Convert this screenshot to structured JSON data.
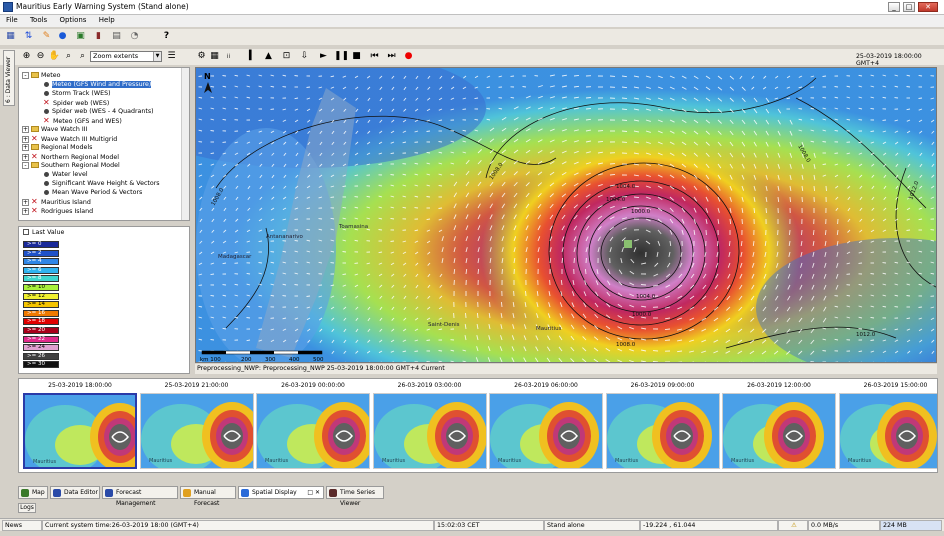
{
  "window": {
    "title": "Mauritius Early Warning System  (Stand alone)"
  },
  "menu": [
    "File",
    "Tools",
    "Options",
    "Help"
  ],
  "toolbar2": {
    "zoom_combo": "Zoom extents",
    "time_display": "25-03-2019 18:00:00 GMT+4"
  },
  "side_tab": "6 : Data Viewer",
  "tree": [
    {
      "label": "Meteo",
      "kind": "folder",
      "level": 0,
      "exp": "-"
    },
    {
      "label": "Meteo (GFS Wind and Pressure)",
      "kind": "dot",
      "level": 1,
      "selected": true
    },
    {
      "label": "Storm Track (WES)",
      "kind": "dot",
      "level": 1
    },
    {
      "label": "Spider web (WES)",
      "kind": "x",
      "level": 1
    },
    {
      "label": "Spider web (WES - 4 Quadrants)",
      "kind": "dot",
      "level": 1
    },
    {
      "label": "Meteo (GFS and WES)",
      "kind": "x",
      "level": 1
    },
    {
      "label": "Wave Watch III",
      "kind": "folder",
      "level": 0,
      "exp": "+"
    },
    {
      "label": "Wave Watch III Multigrid",
      "kind": "x",
      "level": 0,
      "exp": "+"
    },
    {
      "label": "Regional Models",
      "kind": "folder",
      "level": 0,
      "exp": "+"
    },
    {
      "label": "Northern Regional Model",
      "kind": "x",
      "level": 0,
      "exp": "+"
    },
    {
      "label": "Southern Regional Model",
      "kind": "folder",
      "level": 0,
      "exp": "-"
    },
    {
      "label": "Water level",
      "kind": "dot",
      "level": 1
    },
    {
      "label": "Significant Wave Height & Vectors",
      "kind": "dot",
      "level": 1
    },
    {
      "label": "Mean Wave Period & Vectors",
      "kind": "dot",
      "level": 1
    },
    {
      "label": "Mauritius Island",
      "kind": "x",
      "level": 0,
      "exp": "+"
    },
    {
      "label": "Rodrigues Island",
      "kind": "x",
      "level": 0,
      "exp": "+"
    }
  ],
  "legend": {
    "title": "Last Value",
    "rows": [
      {
        "label": ">= 0",
        "color": "#1a2a9a"
      },
      {
        "label": ">= 2",
        "color": "#1f52c8"
      },
      {
        "label": ">= 4",
        "color": "#2f86e6"
      },
      {
        "label": ">= 6",
        "color": "#2fb3f0"
      },
      {
        "label": ">= 8",
        "color": "#3ed6d0"
      },
      {
        "label": ">= 10",
        "color": "#a8f03a",
        "light": true
      },
      {
        "label": ">= 12",
        "color": "#f0f030",
        "light": true
      },
      {
        "label": ">= 14",
        "color": "#f5c400",
        "light": true
      },
      {
        "label": ">= 16",
        "color": "#f07a00"
      },
      {
        "label": ">= 18",
        "color": "#e00000"
      },
      {
        "label": ">= 20",
        "color": "#a8001a"
      },
      {
        "label": ">= 22",
        "color": "#e02a8a"
      },
      {
        "label": ">= 24",
        "color": "#e0a0d0",
        "light": true
      },
      {
        "label": ">= 26",
        "color": "#404040"
      },
      {
        "label": ">= 30",
        "color": "#101010"
      }
    ]
  },
  "map": {
    "north_label": "N",
    "scale_labels": [
      "km 100",
      "200",
      "300",
      "400",
      "500"
    ],
    "contour_labels": [
      "1008.0",
      "1008.0",
      "1004.0",
      "1004.0",
      "1000.0",
      "1008.0",
      "1012.0",
      "1012.0",
      "1004.0",
      "1000.0",
      "1008.0"
    ],
    "place_labels": [
      "Toamasina",
      "Antananarivo",
      "Madagascar",
      "Saint-Denis",
      "Mauritius"
    ],
    "status": "Preprocessing_NWP: Preprocessing_NWP 25-03-2019 18:00:00 GMT+4 Current"
  },
  "thumbnails": [
    {
      "label": "25-03-2019 18:00:00",
      "selected": true
    },
    {
      "label": "25-03-2019 21:00:00"
    },
    {
      "label": "26-03-2019 00:00:00"
    },
    {
      "label": "26-03-2019 03:00:00"
    },
    {
      "label": "26-03-2019 06:00:00"
    },
    {
      "label": "26-03-2019 09:00:00"
    },
    {
      "label": "26-03-2019 12:00:00"
    },
    {
      "label": "26-03-2019 15:00:00"
    }
  ],
  "thumb_place": "Mauritius",
  "tabs": [
    {
      "label": "Map",
      "color": "#3a7a2a"
    },
    {
      "label": "Data Editor",
      "color": "#2a4aa8"
    },
    {
      "label": "Forecast Management",
      "color": "#2a4aa8"
    },
    {
      "label": "Manual Forecast",
      "color": "#e0a020"
    },
    {
      "label": "Spatial Display",
      "color": "#2a6ad8",
      "active": true,
      "closable": true
    },
    {
      "label": "Time Series Viewer",
      "color": "#5a2a2a"
    }
  ],
  "logs_tab": "Logs",
  "status": {
    "news": "News",
    "system_time": "Current system time:26-03-2019 18:00 (GMT+4)",
    "clock": "15:02:03 CET",
    "mode": "Stand alone",
    "coords": "-19.224 , 61.044",
    "rate": "0.0 MB/s",
    "mem": "224 MB"
  }
}
